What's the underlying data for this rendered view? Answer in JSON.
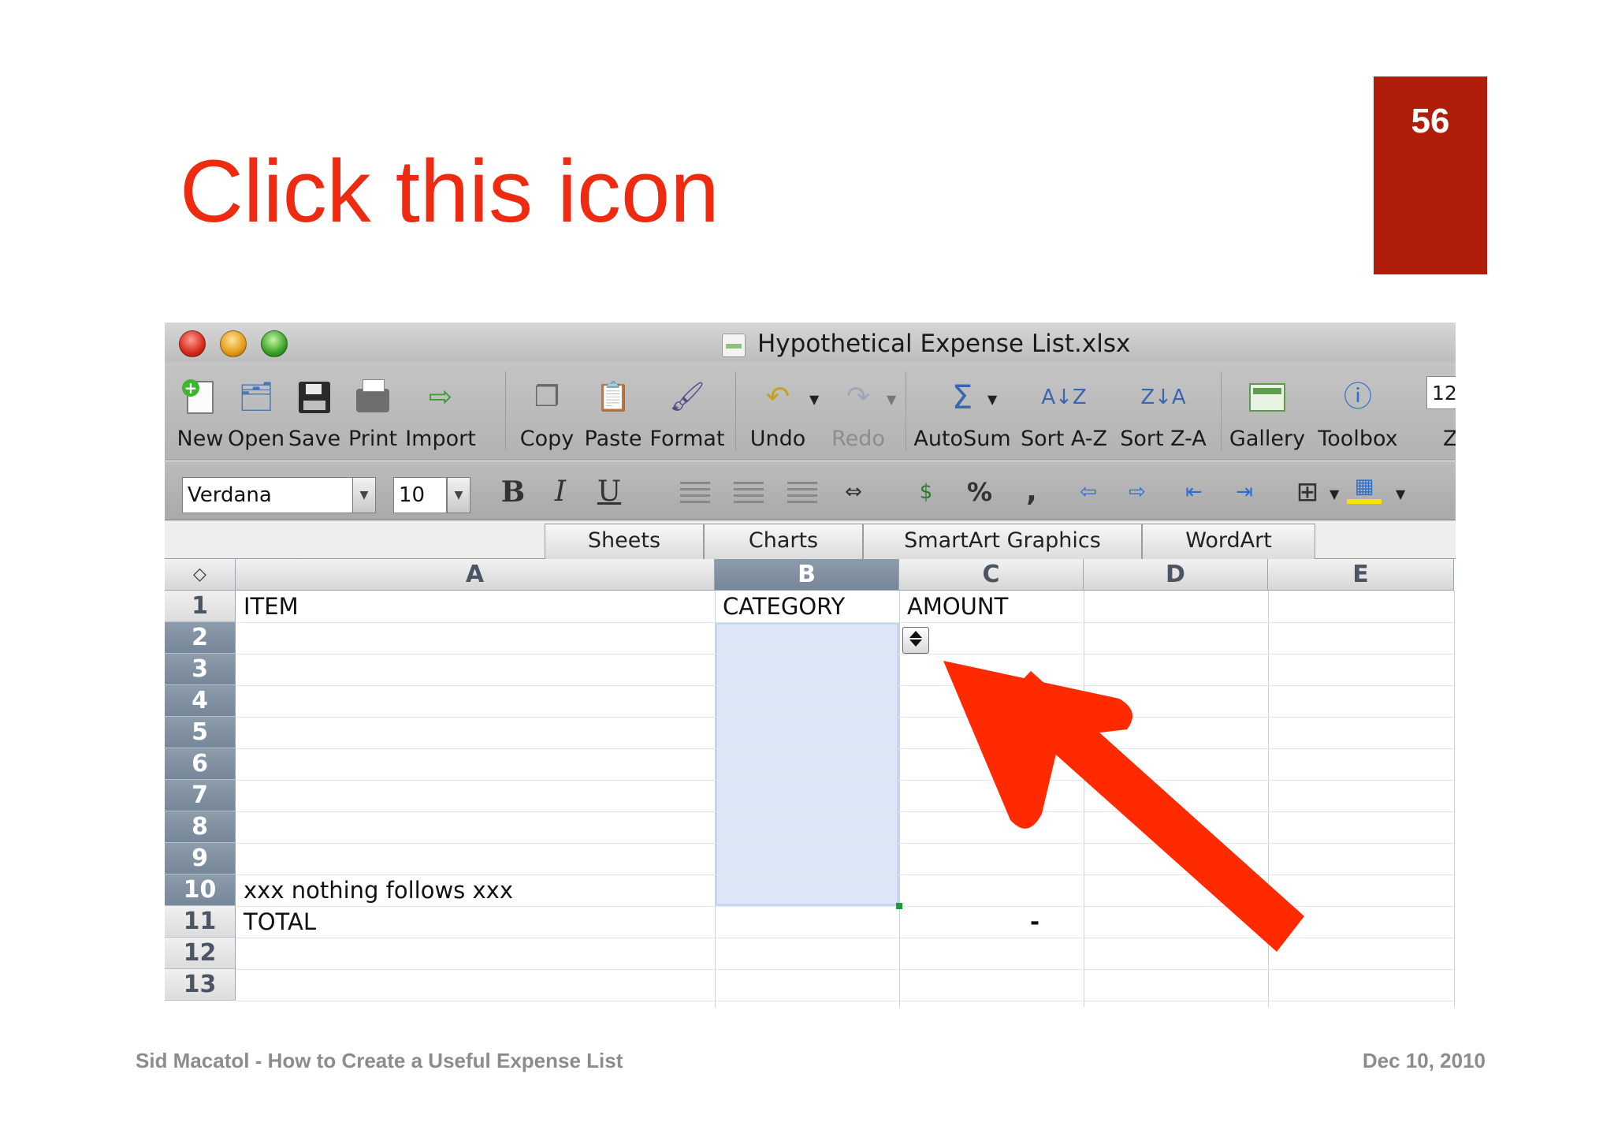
{
  "slide": {
    "title": "Click this icon",
    "page_number": "56",
    "footer_left": "Sid Macatol - How to Create a Useful Expense List",
    "footer_right": "Dec 10, 2010",
    "accent_color": "#ee2a10",
    "badge_color": "#b01d0a",
    "arrow_color": "#ff2a00"
  },
  "window": {
    "title": "Hypothetical Expense List.xlsx"
  },
  "toolbar": {
    "new": "New",
    "open": "Open",
    "save": "Save",
    "print": "Print",
    "import": "Import",
    "copy": "Copy",
    "paste": "Paste",
    "format": "Format",
    "undo": "Undo",
    "redo": "Redo",
    "autosum": "AutoSum",
    "sort_az": "Sort A-Z",
    "sort_za": "Sort Z-A",
    "gallery": "Gallery",
    "toolbox": "Toolbox",
    "zoom_value": "12",
    "zoom_label": "Z"
  },
  "format_bar": {
    "font_name": "Verdana",
    "font_size": "10",
    "bold": "B",
    "italic": "I",
    "underline": "U",
    "percent": "%",
    "comma": ","
  },
  "ribbon_tabs": [
    "Sheets",
    "Charts",
    "SmartArt Graphics",
    "WordArt"
  ],
  "sheet": {
    "columns": [
      "A",
      "B",
      "C",
      "D",
      "E"
    ],
    "rows": [
      "1",
      "2",
      "3",
      "4",
      "5",
      "6",
      "7",
      "8",
      "9",
      "10",
      "11",
      "12",
      "13"
    ],
    "selected_column": "B",
    "cells": {
      "a1": "ITEM",
      "b1": "CATEGORY",
      "c1": "AMOUNT",
      "a10": "xxx nothing follows xxx",
      "a11": "TOTAL",
      "c11": "-"
    }
  }
}
